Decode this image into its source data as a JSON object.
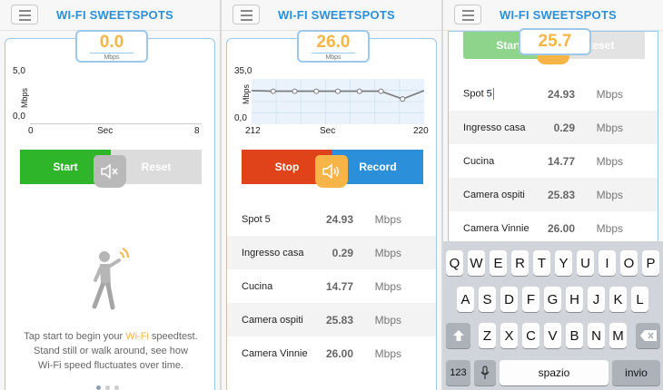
{
  "app": {
    "title": "WI-FI SWEETSPOTS"
  },
  "colors": {
    "accent": "#2b90d9",
    "speed": "#f7b548",
    "start": "#2fb52a",
    "stop": "#e0421a",
    "record": "#2b90d9"
  },
  "panel1": {
    "speed": "0.0",
    "unit": "Mbps",
    "y_max": "5,0",
    "y_min": "0,0",
    "y_axis_label": "Mbps",
    "x_axis_label": "Sec",
    "x_start": "0",
    "x_end": "8",
    "start_label": "Start",
    "reset_label": "Reset",
    "mute_icon": "speaker-mute-icon",
    "help_text_prefix": "Tap start to begin your ",
    "help_text_highlight": "Wi-Fi",
    "help_text_suffix": " speedtest.",
    "help_text_line2": "Stand still or walk around, see how",
    "help_text_line3": "Wi-Fi speed fluctuates over time."
  },
  "panel2": {
    "speed": "26.0",
    "unit": "Mbps",
    "y_max": "35,0",
    "y_min": "0,0",
    "y_axis_label": "Mbps",
    "x_axis_label": "Sec",
    "x_start": "212",
    "x_end": "220",
    "stop_label": "Stop",
    "record_label": "Record",
    "sound_icon": "speaker-on-icon",
    "spots": [
      {
        "name": "Spot 5",
        "speed": "24.93",
        "unit": "Mbps"
      },
      {
        "name": "Ingresso casa",
        "speed": "0.29",
        "unit": "Mbps"
      },
      {
        "name": "Cucina",
        "speed": "14.77",
        "unit": "Mbps"
      },
      {
        "name": "Camera ospiti",
        "speed": "25.83",
        "unit": "Mbps"
      },
      {
        "name": "Camera Vinnie",
        "speed": "26.00",
        "unit": "Mbps"
      }
    ]
  },
  "chart_data": {
    "type": "line",
    "x": [
      212,
      213,
      214,
      215,
      216,
      217,
      218,
      219,
      220
    ],
    "values": [
      26.0,
      25.5,
      25.5,
      25.5,
      25.5,
      25.5,
      25.5,
      19.5,
      26.0
    ],
    "xlabel": "Sec",
    "ylabel": "Mbps",
    "xlim": [
      212,
      220
    ],
    "ylim": [
      0,
      35
    ],
    "grid": true
  },
  "panel3": {
    "speed": "25.7",
    "start_label": "Start",
    "reset_label": "Reset",
    "spots": [
      {
        "name": "Spot 5",
        "speed": "24.93",
        "unit": "Mbps"
      },
      {
        "name": "Ingresso casa",
        "speed": "0.29",
        "unit": "Mbps"
      },
      {
        "name": "Cucina",
        "speed": "14.77",
        "unit": "Mbps"
      },
      {
        "name": "Camera ospiti",
        "speed": "25.83",
        "unit": "Mbps"
      },
      {
        "name": "Camera Vinnie",
        "speed": "26.00",
        "unit": "Mbps"
      }
    ],
    "keyboard": {
      "row1": [
        "Q",
        "W",
        "E",
        "R",
        "T",
        "Y",
        "U",
        "I",
        "O",
        "P"
      ],
      "row2": [
        "A",
        "S",
        "D",
        "F",
        "G",
        "H",
        "J",
        "K",
        "L"
      ],
      "row3": [
        "Z",
        "X",
        "C",
        "V",
        "B",
        "N",
        "M"
      ],
      "shift_icon": "shift-arrow-icon",
      "delete_icon": "backspace-icon",
      "numbers_label": "123",
      "mic_icon": "microphone-icon",
      "space_label": "spazio",
      "return_label": "invio"
    }
  }
}
